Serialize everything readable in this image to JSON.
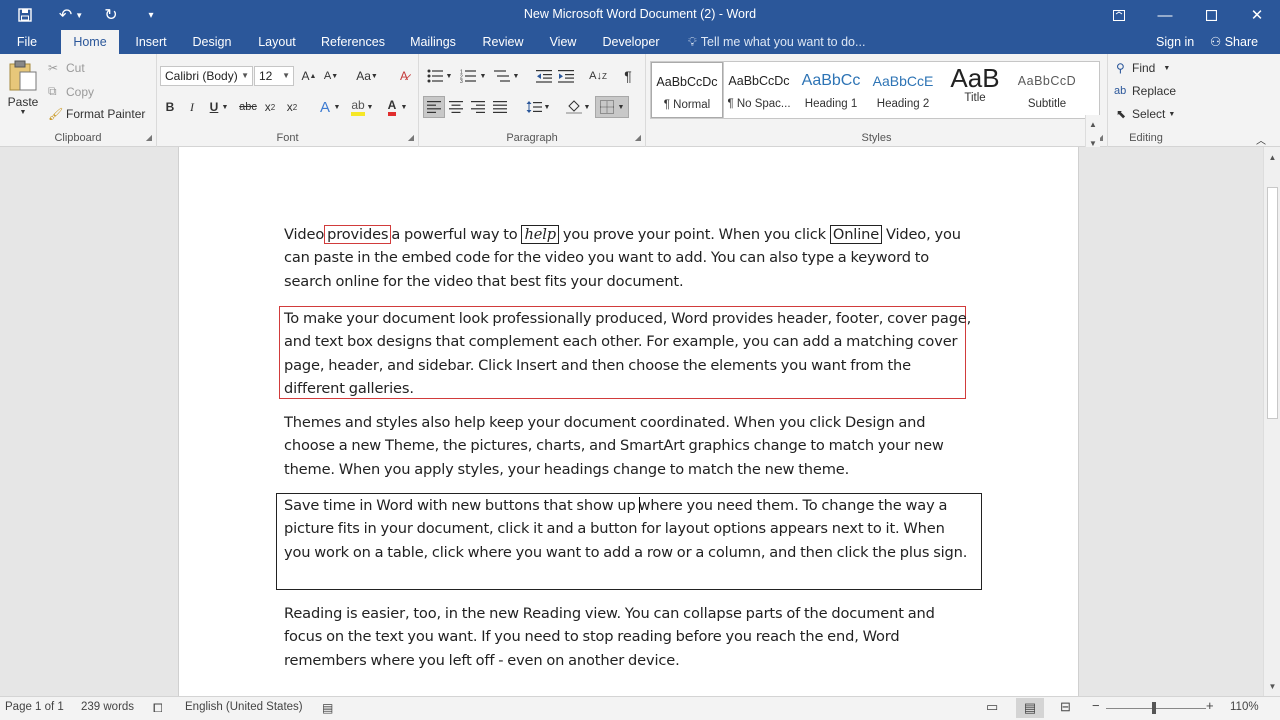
{
  "window": {
    "title": "New Microsoft Word Document (2) - Word"
  },
  "tabs": [
    "File",
    "Home",
    "Insert",
    "Design",
    "Layout",
    "References",
    "Mailings",
    "Review",
    "View",
    "Developer"
  ],
  "tell_me": "Tell me what you want to do...",
  "account": {
    "sign_in": "Sign in",
    "share": "Share"
  },
  "clipboard": {
    "paste": "Paste",
    "cut": "Cut",
    "copy": "Copy",
    "format_painter": "Format Painter",
    "label": "Clipboard"
  },
  "font": {
    "name": "Calibri (Body)",
    "size": "12",
    "label": "Font"
  },
  "paragraph": {
    "label": "Paragraph"
  },
  "styles": {
    "label": "Styles",
    "items": [
      {
        "sample": "AaBbCcDc",
        "name": "¶ Normal"
      },
      {
        "sample": "AaBbCcDc",
        "name": "¶ No Spac..."
      },
      {
        "sample": "AaBbCc",
        "name": "Heading 1"
      },
      {
        "sample": "AaBbCcE",
        "name": "Heading 2"
      },
      {
        "sample": "AaB",
        "name": "Title"
      },
      {
        "sample": "AaBbCcD",
        "name": "Subtitle"
      }
    ]
  },
  "editing": {
    "find": "Find",
    "replace": "Replace",
    "select": "Select",
    "label": "Editing"
  },
  "document": {
    "p1": {
      "a": "Video",
      "b": "provides",
      "c": "a powerful way to",
      "d": "help",
      "e": "you prove your point. When you click",
      "f": "Online",
      "g": "Video, you can paste in the embed code for the video you want to add. You can also type a keyword to search online for the video that best fits your document."
    },
    "p2": "To make your document look professionally produced, Word provides header, footer, cover page, and text box designs that complement each other. For example, you can add a matching cover page, header, and sidebar. Click Insert and then choose the elements you want from the different galleries.",
    "p3": "Themes and styles also help keep your document coordinated. When you click Design and choose a new Theme, the pictures, charts, and SmartArt graphics change to match your new theme. When you apply styles, your headings change to match the new theme.",
    "p4a": "Save time in Word with new buttons that show up",
    "p4b": "where you need them. To change the way a picture fits in your document, click it and a button for layout options appears next to it. When you work on a table, click where you want to add a row or a column, and then click the plus sign.",
    "p5": "Reading is easier, too, in the new Reading view. You can collapse parts of the document and focus on the text you want. If you need to stop reading before you reach the end, Word remembers where you left off - even on another device."
  },
  "status": {
    "page": "Page 1 of 1",
    "words": "239 words",
    "language": "English (United States)",
    "zoom": "110%"
  },
  "colors": {
    "brand": "#2b579a",
    "ink_red": "#d13b3b"
  }
}
